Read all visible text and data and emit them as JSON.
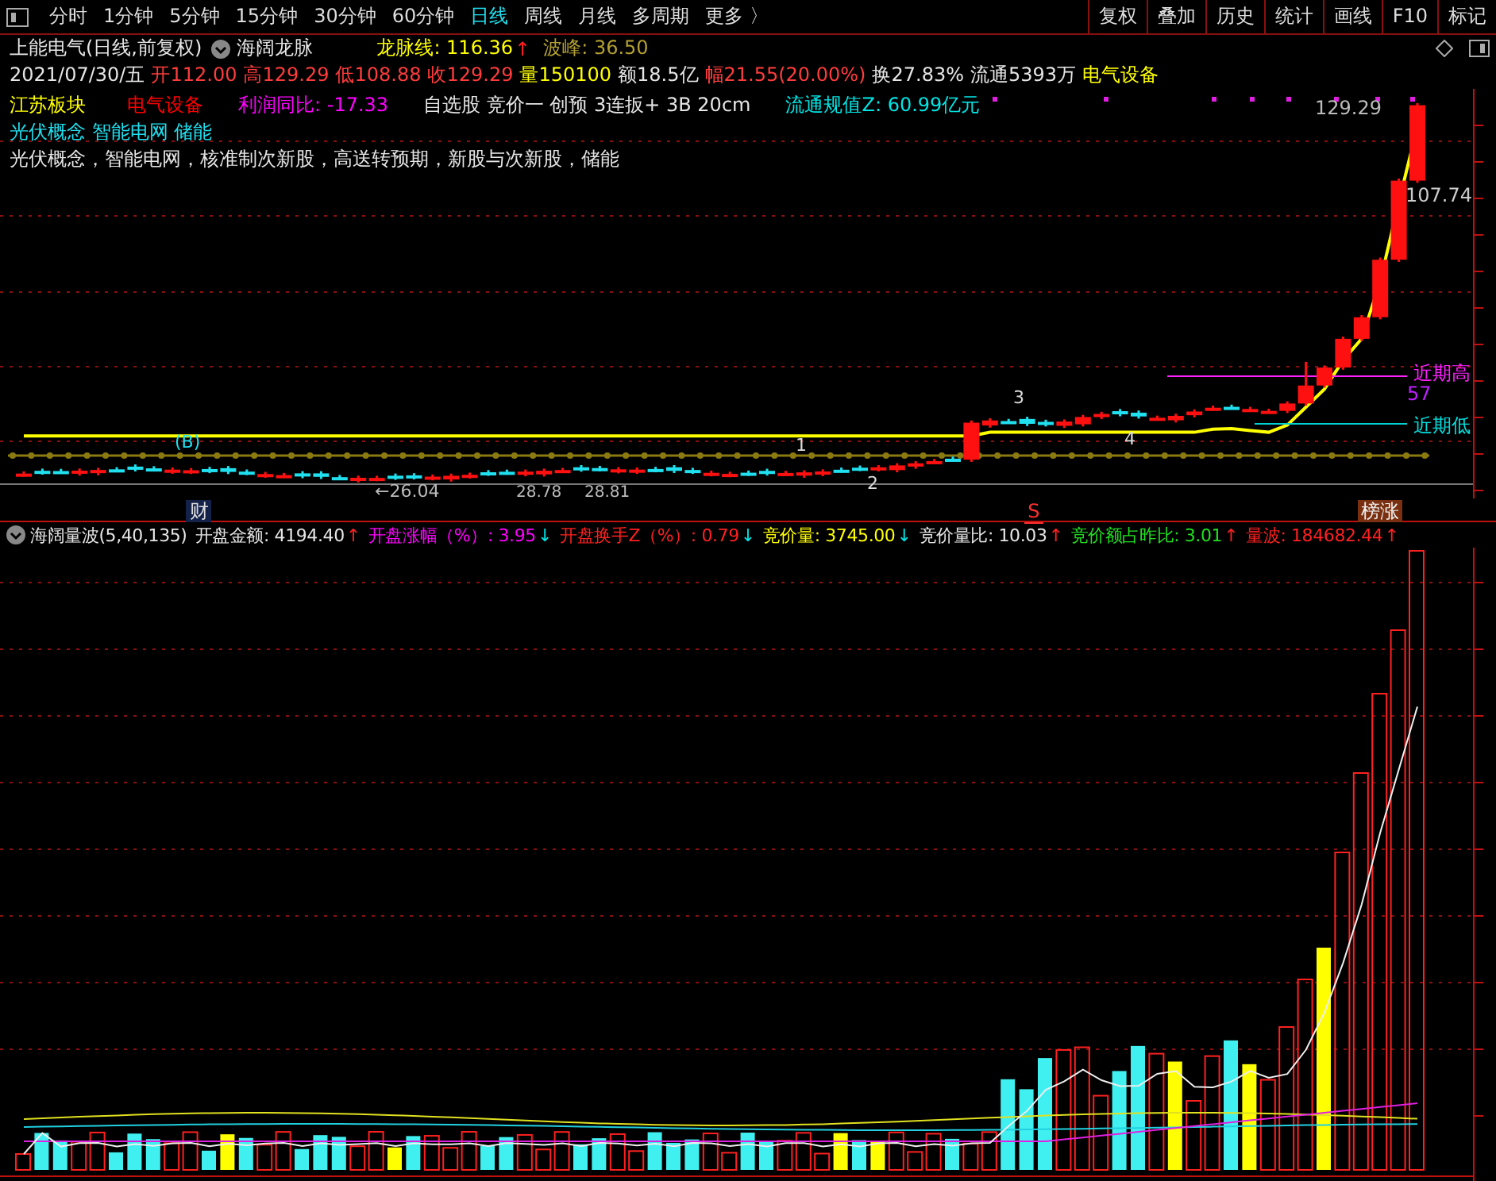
{
  "toolbar": {
    "periods": [
      {
        "label": "分时",
        "selected": false
      },
      {
        "label": "1分钟",
        "selected": false
      },
      {
        "label": "5分钟",
        "selected": false
      },
      {
        "label": "15分钟",
        "selected": false
      },
      {
        "label": "30分钟",
        "selected": false
      },
      {
        "label": "60分钟",
        "selected": false
      },
      {
        "label": "日线",
        "selected": true
      },
      {
        "label": "周线",
        "selected": false
      },
      {
        "label": "月线",
        "selected": false
      },
      {
        "label": "多周期",
        "selected": false
      },
      {
        "label": "更多 〉",
        "selected": false
      }
    ],
    "tools": [
      "复权",
      "叠加",
      "历史",
      "统计",
      "画线",
      "F10",
      "标记"
    ]
  },
  "title_bar": {
    "stock": "上能电气(日线,前复权)",
    "indicator": "海阔龙脉",
    "values": [
      {
        "text": "龙脉线: 116.36",
        "color": "#ffff00",
        "arrow": {
          "text": "↑",
          "color": "#ff2020"
        }
      },
      {
        "text": "波峰: 36.50",
        "color": "#b4a032"
      }
    ]
  },
  "quote": {
    "date": "2021/07/30/五",
    "items": [
      {
        "text": "开112.00",
        "color": "#ff3c3c"
      },
      {
        "text": "高129.29",
        "color": "#ff3c3c"
      },
      {
        "text": "低108.88",
        "color": "#ff3c3c"
      },
      {
        "text": "收129.29",
        "color": "#ff3c3c"
      },
      {
        "text": "量150100",
        "color": "#ffff00"
      },
      {
        "text": "额18.5亿",
        "color": "#e6e6e6"
      },
      {
        "text": "幅21.55(20.00%)",
        "color": "#ff3c3c"
      },
      {
        "text": "换27.83%",
        "color": "#e6e6e6"
      },
      {
        "text": "流通5393万",
        "color": "#e6e6e6"
      },
      {
        "text": "电气设备",
        "color": "#ffff00"
      }
    ]
  },
  "overlay": {
    "tags": [
      {
        "text": "江苏板块",
        "color": "#ffff00"
      },
      {
        "text": "电气设备",
        "color": "#ff0000"
      },
      {
        "text": "利润同比: -17.33",
        "color": "#ff00ff"
      },
      {
        "text": "自选股 竞价一 创预 3连扳+ 3B 20cm",
        "color": "#e6e6e6"
      },
      {
        "text": "流通规值Z: 60.99亿元",
        "color": "#00e5e5"
      }
    ],
    "concepts": "光伏概念 智能电网 储能",
    "description": "光伏概念，智能电网，核准制次新股，高送转预期，新股与次新股，储能"
  },
  "price_labels": {
    "high": "129.29",
    "previous": "107.74",
    "recent_high": "近期高",
    "recent_high_value": "57",
    "recent_low": "近期低",
    "marks": [
      "3",
      "4",
      "1",
      "2",
      "(B)"
    ],
    "lows": [
      "←26.04",
      "28.78",
      "28.81"
    ]
  },
  "markers": [
    "财",
    "S",
    "榜涨"
  ],
  "volume_header": {
    "name": "海阔量波(5,40,135)",
    "values": [
      {
        "text": "开盘金额: 4194.40",
        "color": "#e6e6e6",
        "arrow": {
          "text": "↑",
          "color": "#ff2020"
        }
      },
      {
        "text": "开盘涨幅（%）: 3.95",
        "color": "#ff00ff",
        "arrow": {
          "text": "↓",
          "color": "#00e5e5"
        }
      },
      {
        "text": "开盘换手Z（%）: 0.79",
        "color": "#ff2020",
        "arrow": {
          "text": "↓",
          "color": "#00e5e5"
        }
      },
      {
        "text": "竞价量: 3745.00",
        "color": "#ffff00",
        "arrow": {
          "text": "↓",
          "color": "#00e5e5"
        }
      },
      {
        "text": "竞价量比: 10.03",
        "color": "#e6e6e6",
        "arrow": {
          "text": "↑",
          "color": "#ff2020"
        }
      },
      {
        "text": "竞价额占昨比: 3.01",
        "color": "#20e020",
        "arrow": {
          "text": "↑",
          "color": "#ff2020"
        }
      },
      {
        "text": "量波: 184682.44",
        "color": "#ff2020",
        "arrow": {
          "text": "↑",
          "color": "#ff2020"
        }
      }
    ]
  }
}
